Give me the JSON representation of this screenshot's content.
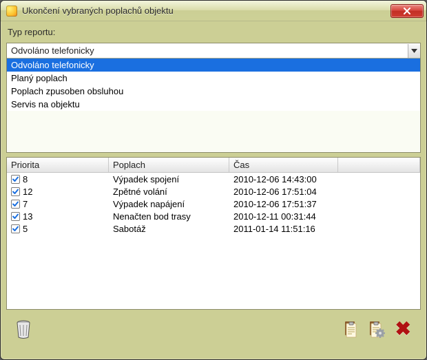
{
  "window": {
    "title": "Ukončení vybraných poplachů objektu"
  },
  "report_type": {
    "label": "Typ reportu:",
    "selected": "Odvoláno telefonicky",
    "options": [
      "Odvoláno telefonicky",
      "Planý poplach",
      "Poplach zpusoben obsluhou",
      "Servis na objektu"
    ]
  },
  "grid": {
    "headers": {
      "priority": "Priorita",
      "alarm": "Poplach",
      "time": "Čas"
    },
    "rows": [
      {
        "checked": true,
        "priority": "8",
        "alarm": "Výpadek spojení",
        "time": "2010-12-06 14:43:00"
      },
      {
        "checked": true,
        "priority": "12",
        "alarm": "Zpětné volání",
        "time": "2010-12-06 17:51:04"
      },
      {
        "checked": true,
        "priority": "7",
        "alarm": "Výpadek napájení",
        "time": "2010-12-06 17:51:37"
      },
      {
        "checked": true,
        "priority": "13",
        "alarm": "Nenačten bod trasy",
        "time": "2010-12-11 00:31:44"
      },
      {
        "checked": true,
        "priority": "5",
        "alarm": "Sabotáž",
        "time": "2011-01-14 11:51:16"
      }
    ]
  }
}
